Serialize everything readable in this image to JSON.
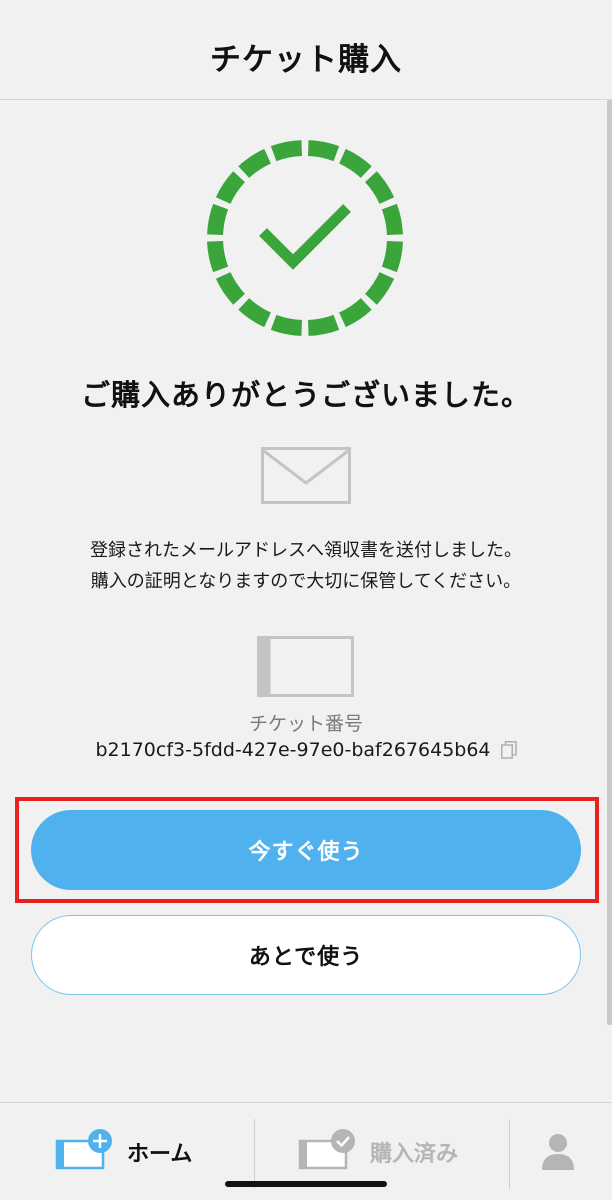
{
  "header": {
    "title": "チケット購入"
  },
  "success": {
    "icon": "check-circle-icon",
    "color": "#3aa53a",
    "message": "ご購入ありがとうございました。"
  },
  "mail_notice": {
    "icon": "envelope-icon",
    "line1": "登録されたメールアドレスへ領収書を送付しました。",
    "line2": "購入の証明となりますので大切に保管してください。"
  },
  "ticket": {
    "icon": "ticket-icon",
    "label": "チケット番号",
    "number": "b2170cf3-5fdd-427e-97e0-baf267645b64",
    "copy_icon": "copy-icon"
  },
  "buttons": {
    "use_now": "今すぐ使う",
    "use_later": "あとで使う"
  },
  "tabs": [
    {
      "label": "ホーム",
      "icon": "ticket-plus-icon",
      "active": true
    },
    {
      "label": "購入済み",
      "icon": "ticket-check-icon",
      "active": false
    },
    {
      "label": "",
      "icon": "user-icon",
      "active": false
    }
  ],
  "colors": {
    "accent": "#4fb1ee",
    "highlight": "#e5221f",
    "success": "#3aa53a"
  }
}
